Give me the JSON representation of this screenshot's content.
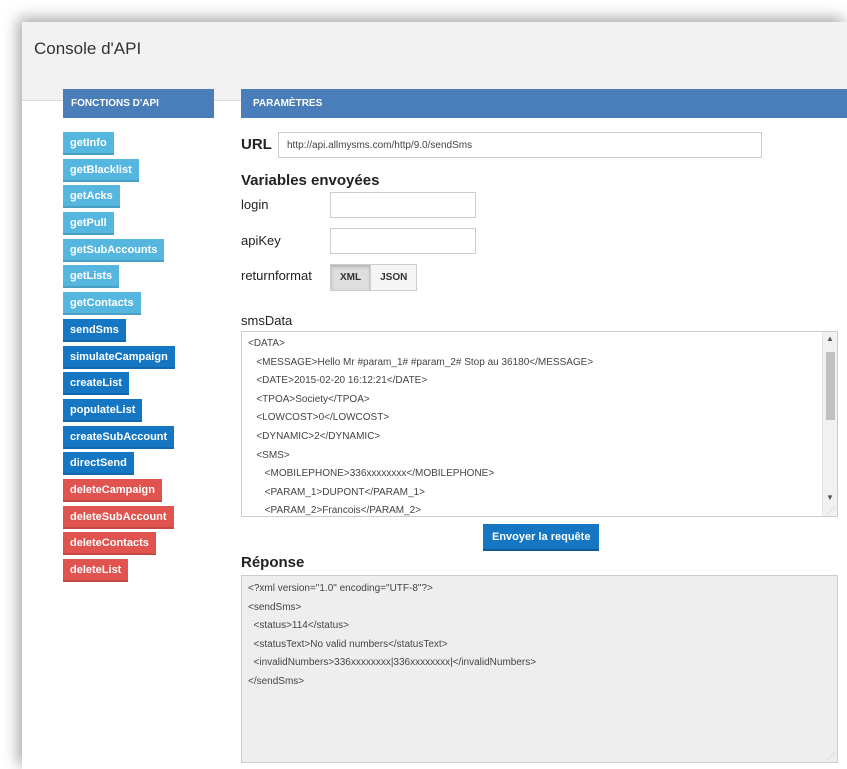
{
  "app": {
    "title": "Console d'API"
  },
  "left_panel": {
    "header": "FONCTIONS D'API",
    "functions": [
      {
        "label": "getInfo",
        "color": "#55b6e0"
      },
      {
        "label": "getBlacklist",
        "color": "#55b6e0"
      },
      {
        "label": "getAcks",
        "color": "#55b6e0"
      },
      {
        "label": "getPull",
        "color": "#55b6e0"
      },
      {
        "label": "getSubAccounts",
        "color": "#55b6e0"
      },
      {
        "label": "getLists",
        "color": "#55b6e0"
      },
      {
        "label": "getContacts",
        "color": "#55b6e0"
      },
      {
        "label": "sendSms",
        "color": "#1577c4"
      },
      {
        "label": "simulateCampaign",
        "color": "#1577c4"
      },
      {
        "label": "createList",
        "color": "#1577c4"
      },
      {
        "label": "populateList",
        "color": "#1577c4"
      },
      {
        "label": "createSubAccount",
        "color": "#1577c4"
      },
      {
        "label": "directSend",
        "color": "#1577c4"
      },
      {
        "label": "deleteCampaign",
        "color": "#e0534f"
      },
      {
        "label": "deleteSubAccount",
        "color": "#e0534f"
      },
      {
        "label": "deleteContacts",
        "color": "#e0534f"
      },
      {
        "label": "deleteList",
        "color": "#e0534f"
      }
    ]
  },
  "params": {
    "header": "PARAMÈTRES",
    "url_label": "URL",
    "url_value": "http://api.allmysms.com/http/9.0/sendSms",
    "vars_title": "Variables envoyées",
    "login_label": "login",
    "login_value": "",
    "apikey_label": "apiKey",
    "apikey_value": "",
    "returnformat_label": "returnformat",
    "returnformat_options": [
      "XML",
      "JSON"
    ],
    "returnformat_selected": "XML",
    "smsdata_label": "smsData",
    "smsdata_lines": [
      "<DATA>",
      "   <MESSAGE>Hello Mr #param_1# #param_2# Stop au 36180</MESSAGE>",
      "   <DATE>2015-02-20 16:12:21</DATE>",
      "   <TPOA>Society</TPOA>",
      "   <LOWCOST>0</LOWCOST>",
      "   <DYNAMIC>2</DYNAMIC>",
      "   <SMS>",
      "      <MOBILEPHONE>336xxxxxxxx</MOBILEPHONE>",
      "      <PARAM_1>DUPONT</PARAM_1>",
      "      <PARAM_2>Francois</PARAM_2>"
    ],
    "send_button": "Envoyer la requête"
  },
  "response": {
    "title": "Réponse",
    "lines": [
      "<?xml version=\"1.0\" encoding=\"UTF-8\"?>",
      "<sendSms>",
      "  <status>114</status>",
      "  <statusText>No valid numbers</statusText>",
      "  <invalidNumbers>336xxxxxxxx|336xxxxxxxx|</invalidNumbers>",
      "</sendSms>"
    ]
  }
}
